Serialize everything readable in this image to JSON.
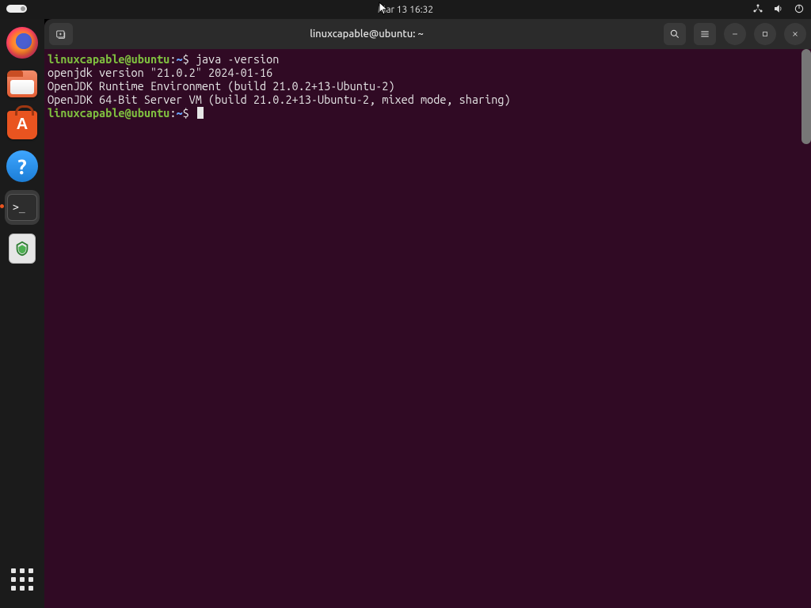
{
  "top_panel": {
    "clock": "Mar 13  16:32"
  },
  "window": {
    "title": "linuxcapable@ubuntu: ~"
  },
  "terminal": {
    "prompt": {
      "user": "linuxcapable",
      "at": "@",
      "host": "ubuntu",
      "sep": ":",
      "path": "~",
      "dollar": "$"
    },
    "command1": "java -version",
    "output1": "openjdk version \"21.0.2\" 2024-01-16",
    "output2": "OpenJDK Runtime Environment (build 21.0.2+13-Ubuntu-2)",
    "output3": "OpenJDK 64-Bit Server VM (build 21.0.2+13-Ubuntu-2, mixed mode, sharing)"
  },
  "dock": {
    "help_glyph": "?",
    "terminal_glyph": ">_"
  }
}
